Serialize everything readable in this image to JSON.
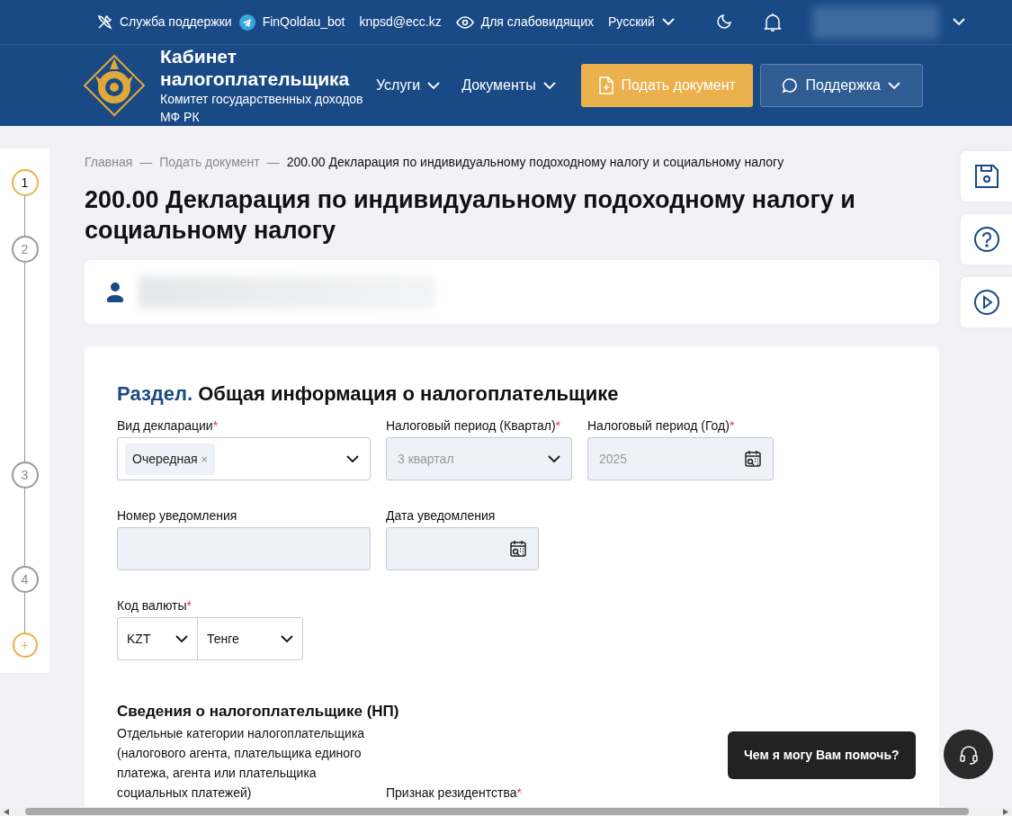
{
  "topbar": {
    "support": "Служба поддержки",
    "telegram": "FinQoldau_bot",
    "email": "knpsd@ecc.kz",
    "accessibility": "Для слабовидящих",
    "language": "Русский"
  },
  "header": {
    "title": "Кабинет налогоплательщика",
    "subtitle": "Комитет государственных доходов МФ РК",
    "nav": [
      "Услуги",
      "Документы"
    ],
    "submit_button": "Подать документ",
    "support_button": "Поддержка"
  },
  "breadcrumb": [
    {
      "label": "Главная",
      "current": false
    },
    {
      "separator_before": "—",
      "label": "Подать документ",
      "current": false
    },
    {
      "separator_before": "—",
      "label": "200.00 Декларация по индивидуальному подоходному налогу и социальному налогу",
      "current": true
    }
  ],
  "page_title": "200.00 Декларация по индивидуальному подоходному налогу и социальному налогу",
  "steps": [
    {
      "label": "1",
      "kind": "step",
      "selected": true
    },
    {
      "label": "2",
      "kind": "step",
      "selected": false
    },
    {
      "label": "3",
      "kind": "step",
      "selected": false
    },
    {
      "label": "4",
      "kind": "step",
      "selected": false
    },
    {
      "label": "+",
      "kind": "add"
    }
  ],
  "section": {
    "prefix": "Раздел.",
    "title": "Общая информация о налогоплательщике"
  },
  "field_rows": [
    [
      {
        "label": "Вид декларации",
        "required_mark": "*",
        "kind": "tag-select",
        "disabled": false,
        "value": "Очередная",
        "remove": "×"
      },
      {
        "label": "Налоговый период (Квартал)",
        "required_mark": "*",
        "kind": "select",
        "disabled": true,
        "value": "3 квартал"
      },
      {
        "label": "Налоговый период (Год)",
        "required_mark": "*",
        "kind": "date",
        "disabled": true,
        "value": "2025"
      }
    ],
    [
      {
        "label": "Номер уведомления",
        "kind": "text",
        "disabled": true
      },
      {
        "label": "Дата уведомления",
        "kind": "date",
        "disabled": true
      }
    ],
    [
      {
        "label": "Код валюты",
        "required_mark": "*",
        "kind": "currency",
        "disabled": false,
        "code": "KZT",
        "name": "Тенге"
      }
    ]
  ],
  "subsection": {
    "title": "Сведения о налогоплательщике (НП)",
    "labels": [
      {
        "label": "Отдельные категории налогоплательщика (налогового агента, плательщика единого платежа, агента или плательщика социальных платежей)"
      },
      {
        "label": "Признак резидентства",
        "required_mark": "*"
      }
    ]
  },
  "chat": {
    "prompt": "Чем я могу Вам помочь?"
  }
}
